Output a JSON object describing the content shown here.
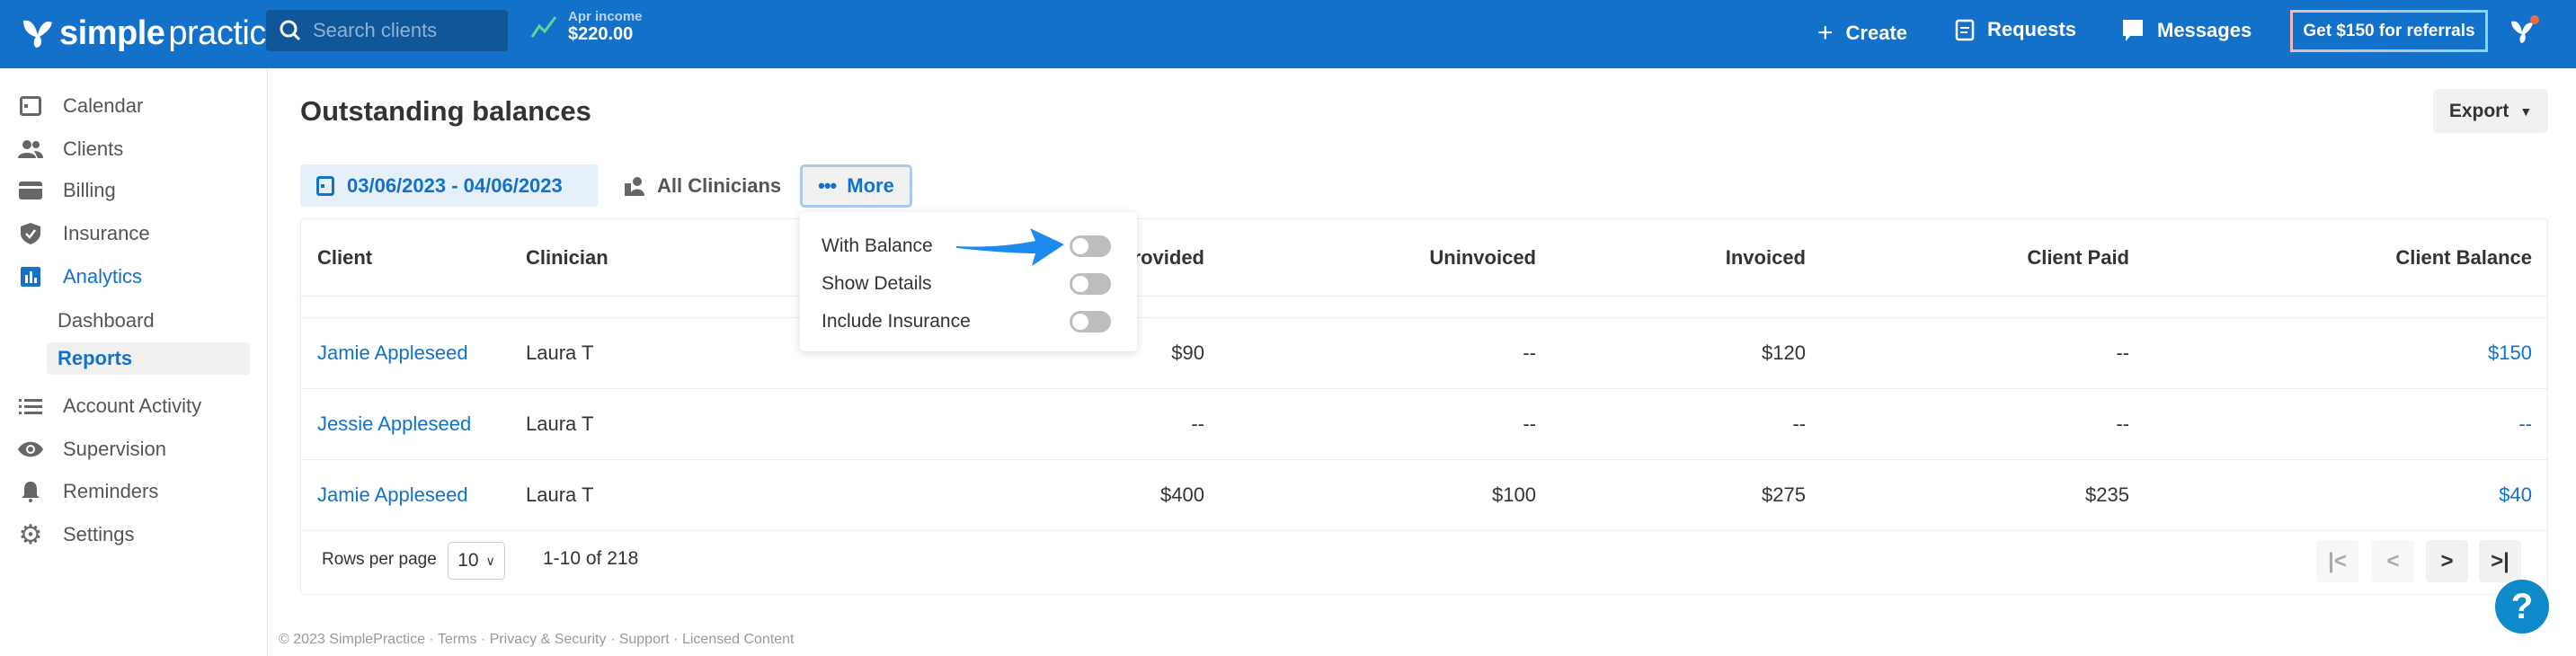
{
  "header": {
    "logo": {
      "bold": "simple",
      "light": "practice"
    },
    "search": {
      "placeholder": "Search clients"
    },
    "income": {
      "label": "Apr income",
      "value": "$220.00"
    },
    "nav": {
      "create": "Create",
      "requests": "Requests",
      "messages": "Messages"
    },
    "referral_button": "Get $150 for referrals",
    "colors": {
      "bar": "#1471c9",
      "notification_dot": "#f26b3a"
    }
  },
  "sidebar": {
    "items": [
      {
        "label": "Calendar",
        "icon": "calendar-icon"
      },
      {
        "label": "Clients",
        "icon": "people-icon"
      },
      {
        "label": "Billing",
        "icon": "credit-card-icon"
      },
      {
        "label": "Insurance",
        "icon": "shield-check-icon"
      },
      {
        "label": "Analytics",
        "icon": "bar-chart-icon",
        "active": true
      },
      {
        "label": "Account Activity",
        "icon": "list-icon"
      },
      {
        "label": "Supervision",
        "icon": "eye-icon"
      },
      {
        "label": "Reminders",
        "icon": "bell-icon"
      },
      {
        "label": "Settings",
        "icon": "gear-icon"
      }
    ],
    "subitems": [
      {
        "label": "Dashboard"
      },
      {
        "label": "Reports",
        "active": true
      }
    ]
  },
  "main": {
    "title": "Outstanding balances",
    "export_label": "Export",
    "filters": {
      "date_range": "03/06/2023 - 04/06/2023",
      "clinicians": "All Clinicians",
      "more": "More"
    },
    "more_menu": [
      {
        "label": "With Balance",
        "on": false
      },
      {
        "label": "Show Details",
        "on": false
      },
      {
        "label": "Include Insurance",
        "on": false
      }
    ],
    "table": {
      "headers": [
        "Client",
        "Clinician",
        "Provided",
        "Uninvoiced",
        "Invoiced",
        "Client Paid",
        "Client Balance"
      ],
      "rows": [
        [
          "Jamie Appleseed",
          "Laura T",
          "$90",
          "--",
          "$120",
          "--",
          "$150"
        ],
        [
          "Jessie Appleseed",
          "Laura T",
          "--",
          "--",
          "--",
          "--",
          "--"
        ],
        [
          "Jamie Appleseed",
          "Laura T",
          "$400",
          "$100",
          "$275",
          "$235",
          "$40"
        ]
      ]
    },
    "pagination": {
      "rows_per_page_label": "Rows per page",
      "rows_per_page": "10",
      "range": "1-10 of 218"
    }
  },
  "footer": "© 2023 SimplePractice · Terms · Privacy & Security · Support · Licensed Content",
  "help": "?"
}
